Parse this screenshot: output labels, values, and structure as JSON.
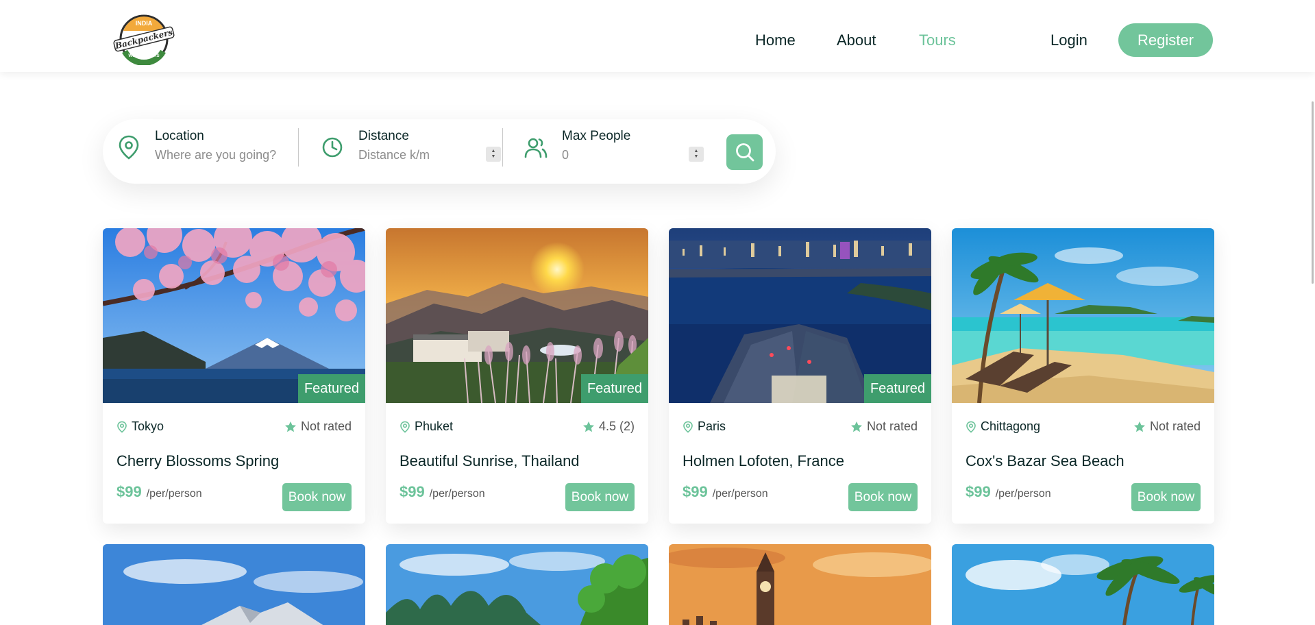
{
  "header": {
    "logo_text": "INDIA Backpackers WORLD TOURS",
    "nav": [
      {
        "label": "Home",
        "active": false
      },
      {
        "label": "About",
        "active": false
      },
      {
        "label": "Tours",
        "active": true
      }
    ],
    "login": "Login",
    "register": "Register"
  },
  "search": {
    "location": {
      "label": "Location",
      "placeholder": "Where are you going?",
      "icon": "map-pin-icon"
    },
    "distance": {
      "label": "Distance",
      "placeholder": "Distance k/m",
      "icon": "clock-icon"
    },
    "people": {
      "label": "Max People",
      "value": "0",
      "icon": "users-icon"
    },
    "button_icon": "search-icon"
  },
  "tours": [
    {
      "city": "Tokyo",
      "rating": "Not rated",
      "title": "Cherry Blossoms Spring",
      "price": "$99",
      "per": "/per/person",
      "book": "Book now",
      "featured": "Featured"
    },
    {
      "city": "Phuket",
      "rating": "4.5 (2)",
      "title": "Beautiful Sunrise, Thailand",
      "price": "$99",
      "per": "/per/person",
      "book": "Book now",
      "featured": "Featured"
    },
    {
      "city": "Paris",
      "rating": "Not rated",
      "title": "Holmen Lofoten, France",
      "price": "$99",
      "per": "/per/person",
      "book": "Book now",
      "featured": "Featured"
    },
    {
      "city": "Chittagong",
      "rating": "Not rated",
      "title": "Cox's Bazar Sea Beach",
      "price": "$99",
      "per": "/per/person",
      "book": "Book now",
      "featured": ""
    }
  ],
  "colors": {
    "accent": "#72c59b",
    "accent_text": "#6cc39a",
    "featured": "#3e9d6d",
    "heading": "#0b2727"
  }
}
